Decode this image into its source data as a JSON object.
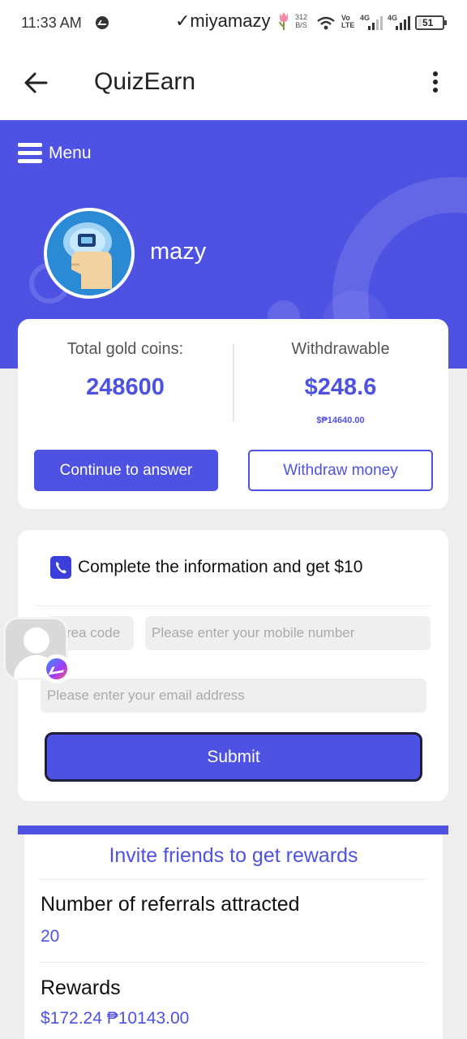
{
  "status_bar": {
    "time": "11:33 AM",
    "user": "✓miyamazy",
    "net_speed_value": "312",
    "net_speed_unit": "B/S",
    "volte_top": "Vo",
    "volte_bottom": "LTE",
    "sim1": "4G",
    "sim2": "4G",
    "battery": "51"
  },
  "app_bar": {
    "title": "QuizEarn"
  },
  "hero": {
    "menu_label": "Menu",
    "username": "mazy"
  },
  "balance": {
    "coins_label": "Total gold coins:",
    "coins_value": "248600",
    "withdrawable_label": "Withdrawable",
    "withdrawable_value": "$248.6",
    "withdrawable_sub": "$₱14640.00",
    "continue_button": "Continue to answer",
    "withdraw_button": "Withdraw money"
  },
  "info_form": {
    "title": "Complete the information and get $10",
    "area_code_placeholder": "rea code",
    "mobile_placeholder": "Please enter your mobile number",
    "email_placeholder": "Please enter your email address",
    "submit_button": "Submit"
  },
  "invite": {
    "title": "Invite friends to get rewards",
    "referrals_label": "Number of referrals attracted",
    "referrals_value": "20",
    "rewards_label": "Rewards",
    "rewards_value": "$172.24 ₱10143.00"
  },
  "colors": {
    "accent": "#4e52e3",
    "background": "#eeeeee"
  }
}
